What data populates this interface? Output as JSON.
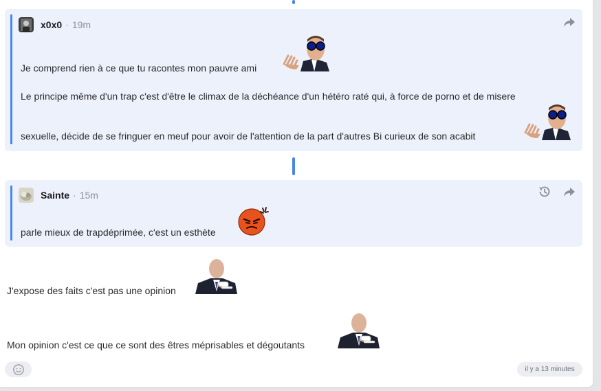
{
  "quotes": [
    {
      "username": "x0x0",
      "separator": "·",
      "time": "19m",
      "icons": [
        "share-arrow-icon"
      ],
      "lines": [
        "Je comprend rien à ce que tu racontes mon pauvre ami",
        "Le principe même d'un trap c'est d'être le climax de la déchéance d'un hétéro raté qui, à force de porno et de misere",
        "sexuelle, décide de se fringuer en meuf pour avoir de l'attention de la part d'autres Bi curieux de son acabit"
      ]
    },
    {
      "username": "Sainte",
      "separator": "·",
      "time": "15m",
      "icons": [
        "history-icon",
        "share-arrow-icon"
      ],
      "lines": [
        "parle mieux de trapdéprimée, c'est un esthète"
      ]
    }
  ],
  "reply": {
    "lines": [
      "J'expose des faits c'est pas une opinion",
      "Mon opinion c'est ce que ce sont des êtres méprisables et dégoutants"
    ]
  },
  "footer": {
    "timestamp": "il y a 13 minutes",
    "react_icon": "smiley-add-icon"
  },
  "colors": {
    "accent": "#4a86e8",
    "quote_bg": "#edf1fc",
    "angry_emoji": "#e8531d"
  }
}
